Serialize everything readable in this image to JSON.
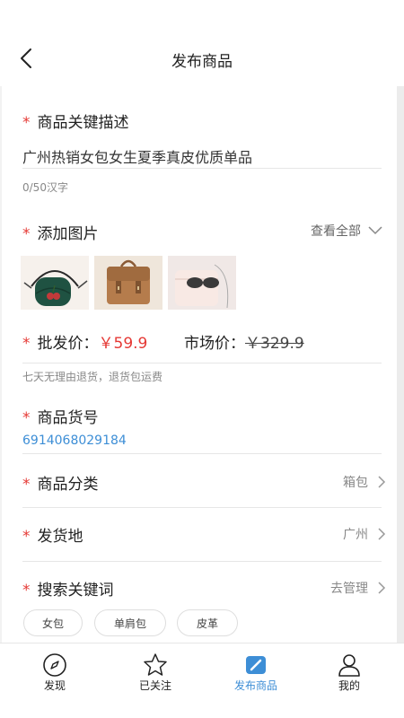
{
  "header": {
    "title": "发布商品",
    "back_icon": "chevron-left-icon"
  },
  "description": {
    "required_mark": "*",
    "label": "商品关键描述",
    "value": "广州热销女包女生夏季真皮优质单品",
    "counter": "0/50汉字"
  },
  "images": {
    "required_mark": "*",
    "label": "添加图片",
    "view_all": "查看全部",
    "view_all_icon": "chevron-down-icon",
    "thumbnails": [
      {
        "name": "green-crossbody-bag-thumbnail"
      },
      {
        "name": "brown-backpack-thumbnail"
      },
      {
        "name": "pink-bag-with-sunglasses-thumbnail"
      }
    ]
  },
  "price": {
    "required_mark": "*",
    "wholesale_label": "批发价：",
    "wholesale_value": "￥59.9",
    "market_label": "市场价：",
    "market_value": "￥329.9",
    "refund_note": "七天无理由退货，退货包运费"
  },
  "sku": {
    "required_mark": "*",
    "label": "商品货号",
    "value": "6914068029184"
  },
  "category": {
    "required_mark": "*",
    "label": "商品分类",
    "value": "箱包"
  },
  "ship_from": {
    "required_mark": "*",
    "label": "发货地",
    "value": "广州"
  },
  "keywords": {
    "required_mark": "*",
    "label": "搜索关键词",
    "manage": "去管理",
    "tags": [
      "女包",
      "单肩包",
      "皮革"
    ]
  },
  "nav": {
    "active_color": "#3d8ed6",
    "items": [
      {
        "label": "发现",
        "icon": "compass-icon"
      },
      {
        "label": "已关注",
        "icon": "star-icon"
      },
      {
        "label": "发布商品",
        "icon": "edit-icon"
      },
      {
        "label": "我的",
        "icon": "user-icon"
      }
    ]
  },
  "colors": {
    "accent_red": "#e53935",
    "link_blue": "#3d8ed6"
  }
}
